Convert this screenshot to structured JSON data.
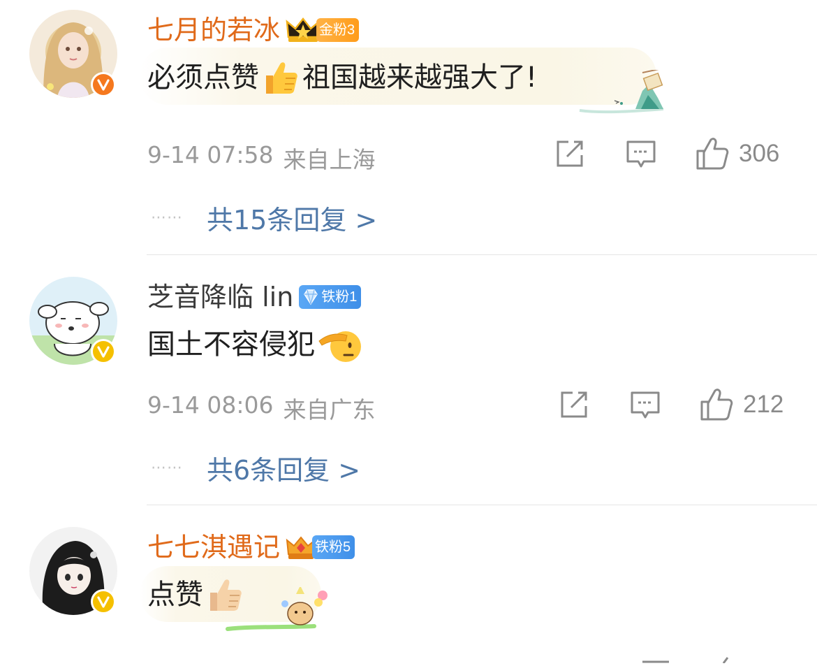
{
  "comments": [
    {
      "username": "七月的若冰",
      "fan_badge": "金粉3",
      "text_before": "必须点赞",
      "text_after": "祖国越来越强大了!",
      "date": "9-14 07:58",
      "location": "来自上海",
      "likes": "306",
      "replies": "共15条回复 >"
    },
    {
      "username": "芝音降临 lin",
      "fan_badge": "铁粉1",
      "text_before": "国土不容侵犯",
      "text_after": "",
      "date": "9-14 08:06",
      "location": "来自广东",
      "likes": "212",
      "replies": "共6条回复 >"
    },
    {
      "username": "七七淇遇记",
      "fan_badge": "铁粉5",
      "text_before": "点赞",
      "text_after": "",
      "date": "",
      "location": "",
      "likes": "",
      "replies": ""
    }
  ],
  "reply_dots": "⋯⋯",
  "icons": {
    "share": "share-icon",
    "comment": "comment-icon",
    "like": "thumbs-up-icon",
    "verified": "verified-v-icon",
    "crown": "crown-icon",
    "diamond": "diamond-icon"
  },
  "colors": {
    "gold_name": "#e06a1a",
    "reply_link": "#4f78a8",
    "meta_gray": "#9a9a9a",
    "verified_orange": "#f5781e",
    "verified_yellow": "#f5c000"
  }
}
